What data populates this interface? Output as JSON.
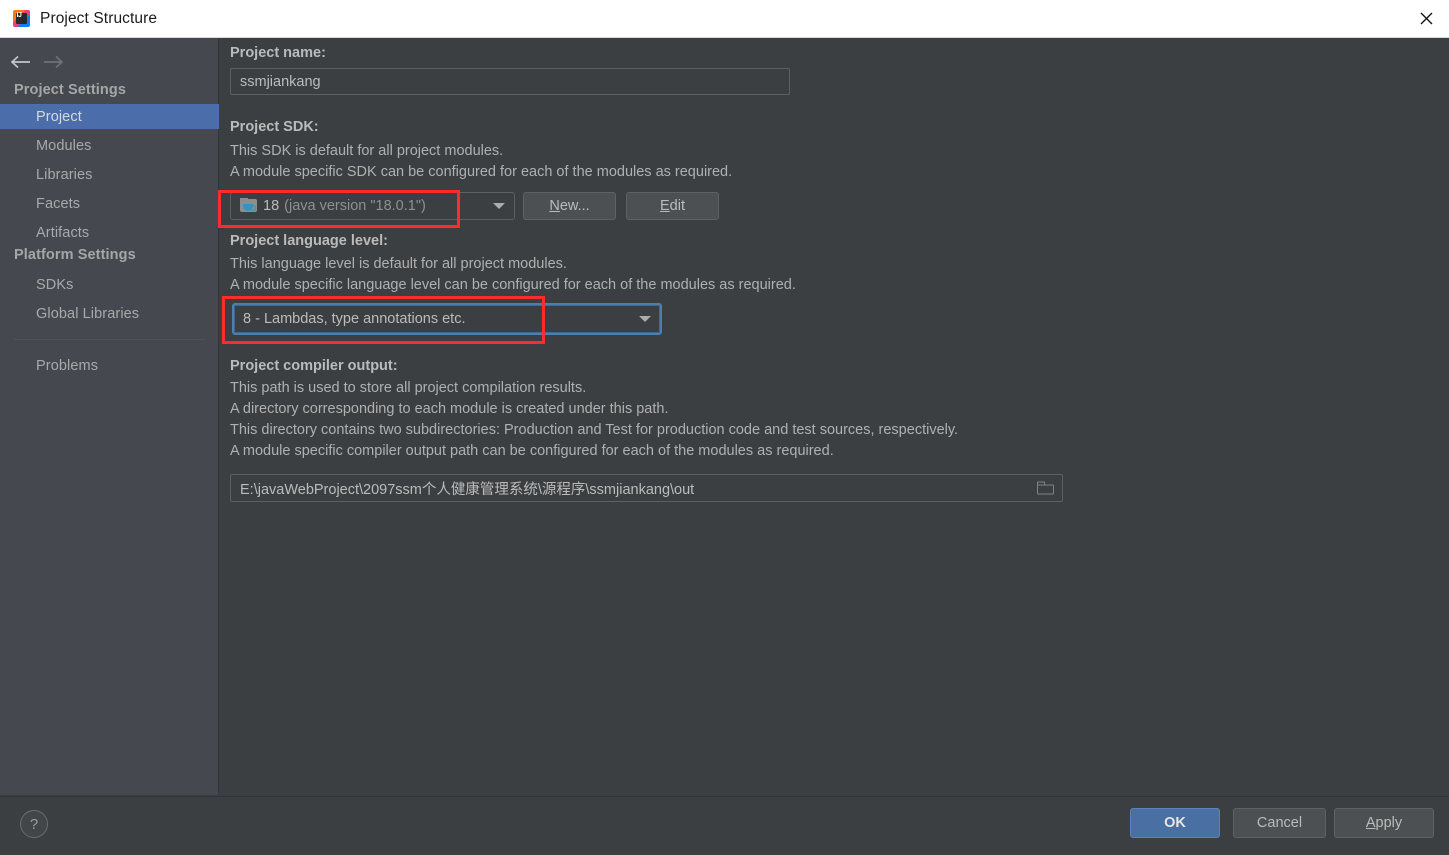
{
  "window": {
    "title": "Project Structure",
    "app_icon": "intellij-idea-icon",
    "close_label": "×"
  },
  "navigation": {
    "back_icon": "arrow-left-icon",
    "forward_icon": "arrow-right-icon"
  },
  "sidebar": {
    "groups": [
      {
        "label": "Project Settings"
      },
      {
        "label": "Platform Settings"
      }
    ],
    "items": [
      {
        "label": "Project",
        "selected": true
      },
      {
        "label": "Modules",
        "selected": false
      },
      {
        "label": "Libraries",
        "selected": false
      },
      {
        "label": "Facets",
        "selected": false
      },
      {
        "label": "Artifacts",
        "selected": false
      },
      {
        "label": "SDKs",
        "selected": false
      },
      {
        "label": "Global Libraries",
        "selected": false
      },
      {
        "label": "Problems",
        "selected": false
      }
    ]
  },
  "main": {
    "project_name": {
      "label": "Project name:",
      "value": "ssmjiankang"
    },
    "project_sdk": {
      "label": "Project SDK:",
      "description_line1": "This SDK is default for all project modules.",
      "description_line2": "A module specific SDK can be configured for each of the modules as required.",
      "selected_version": "18",
      "selected_detail": "(java version \"18.0.1\")",
      "icon": "java-sdk-folder-icon",
      "dropdown_icon": "chevron-down-icon",
      "new_button": "New...",
      "new_button_mnemonic": "N",
      "edit_button": "Edit",
      "edit_button_mnemonic": "E"
    },
    "language_level": {
      "label": "Project language level:",
      "description_line1": "This language level is default for all project modules.",
      "description_line2": "A module specific language level can be configured for each of the modules as required.",
      "value": "8 - Lambdas, type annotations etc.",
      "dropdown_icon": "chevron-down-icon",
      "focused": true
    },
    "compiler_output": {
      "label": "Project compiler output:",
      "description_line1": "This path is used to store all project compilation results.",
      "description_line2": "A directory corresponding to each module is created under this path.",
      "description_line3": "This directory contains two subdirectories: Production and Test for production code and test sources, respectively.",
      "description_line4": "A module specific compiler output path can be configured for each of the modules as required.",
      "path": "E:\\javaWebProject\\2097ssm个人健康管理系统\\源程序\\ssmjiankang\\out",
      "browse_icon": "folder-browse-icon"
    }
  },
  "annotations": {
    "color": "#fb2c2c",
    "boxes": [
      {
        "name": "sdk-highlight"
      },
      {
        "name": "language-level-highlight"
      }
    ]
  },
  "footer": {
    "help_label": "?",
    "help_icon": "question-mark-icon",
    "ok_label": "OK",
    "cancel_label": "Cancel",
    "apply_label": "Apply",
    "apply_mnemonic": "A"
  },
  "colors": {
    "panel_bg": "#3c3f41",
    "sidebar_bg": "#45484f",
    "selection_blue": "#4b6eab",
    "default_button_blue": "#4a6fa3",
    "annotation_red": "#fb2c2c",
    "titlebar_bg": "#ffffff"
  }
}
